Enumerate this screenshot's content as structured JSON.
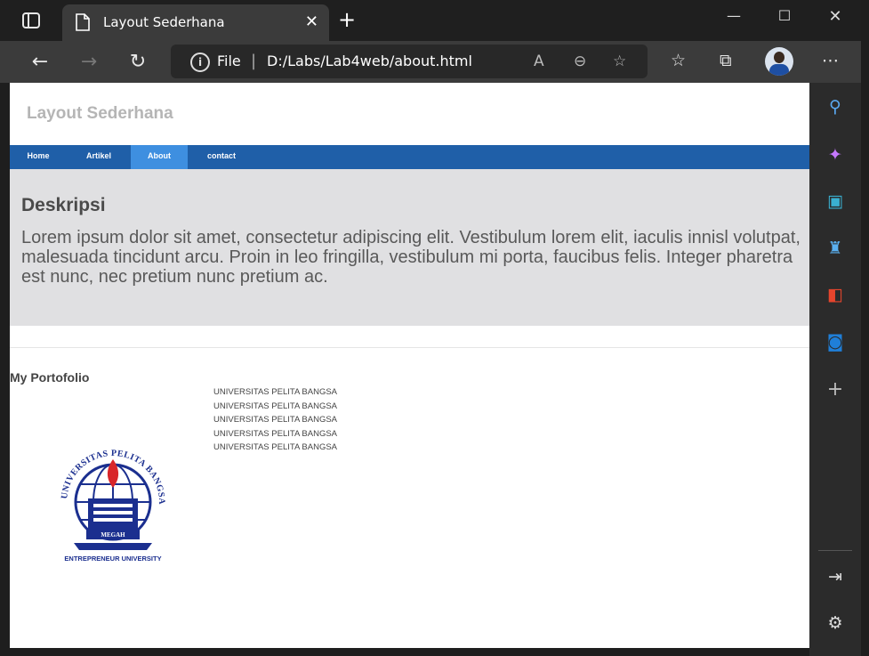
{
  "browser": {
    "tab_title": "Layout Sederhana",
    "scheme_label": "File",
    "url": "D:/Labs/Lab4web/about.html",
    "icons": [
      "tab-actions-icon",
      "page-icon",
      "close-icon",
      "plus-icon",
      "minimize-icon",
      "maximize-icon",
      "close-window-icon",
      "back-icon",
      "forward-icon",
      "refresh-icon",
      "info-icon",
      "read-aloud-icon",
      "zoom-out-icon",
      "add-favorite-icon",
      "favorites-icon",
      "collections-icon",
      "more-icon"
    ]
  },
  "sidebar": {
    "icons": [
      "search-icon",
      "copilot-icon",
      "tools-icon",
      "games-icon",
      "office-icon",
      "outlook-icon",
      "add-icon",
      "hide-sidebar-icon",
      "settings-icon"
    ]
  },
  "page": {
    "site_title": "Layout Sederhana",
    "nav": [
      "Home",
      "Artikel",
      "About",
      "contact"
    ],
    "active_nav": "About",
    "hero_title": "Deskripsi",
    "hero_text": "Lorem ipsum dolor sit amet, consectetur adipiscing elit. Vestibulum lorem elit, iaculis innisl volutpat, malesuada tincidunt arcu. Proin in leo fringilla, vestibulum mi porta, faucibus felis. Integer pharetra est nunc, nec pretium nunc pretium ac.",
    "portfolio_title": "My Portofolio",
    "universities": [
      "UNIVERSITAS PELITA BANGSA",
      "UNIVERSITAS PELITA BANGSA",
      "UNIVERSITAS PELITA BANGSA",
      "UNIVERSITAS PELITA BANGSA",
      "UNIVERSITAS PELITA BANGSA"
    ],
    "logo": {
      "arc_text": "UNIVERSITAS PELITA BANGSA",
      "band_text": "MEGAH",
      "bottom_text": "ENTREPRENEUR UNIVERSITY"
    }
  },
  "colors": {
    "nav_bg": "#1f5fa8",
    "nav_active": "#3e8fe0",
    "hero_bg": "#e0e0e2",
    "logo_blue": "#1b2f8f",
    "logo_red": "#d8262a"
  }
}
